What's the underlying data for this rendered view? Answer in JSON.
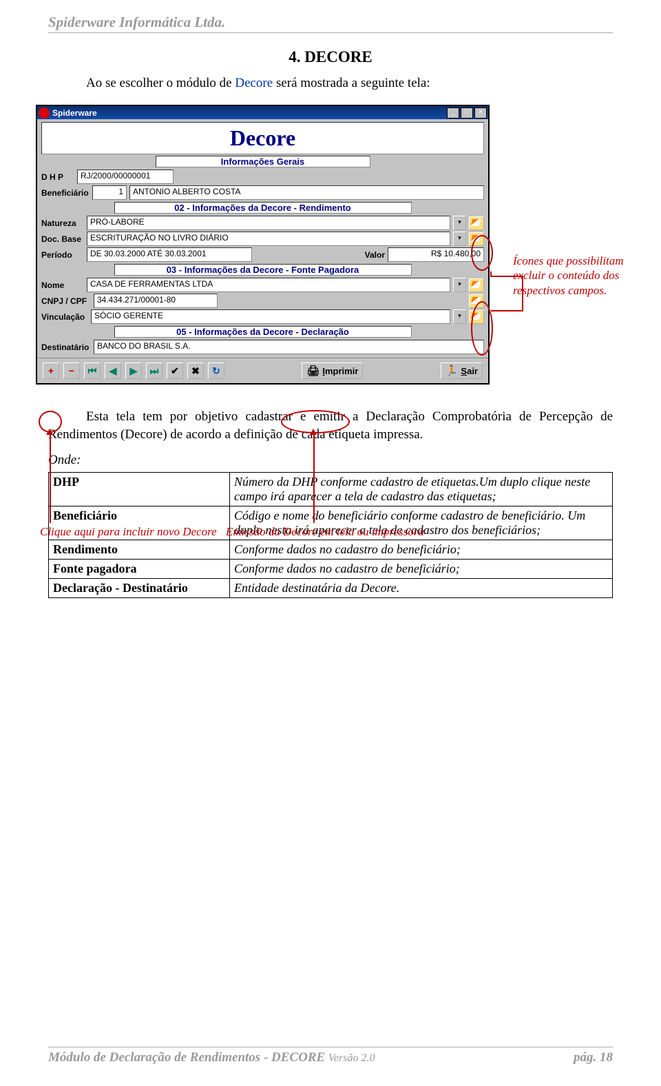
{
  "header": "Spiderware Informática Ltda.",
  "section_title": "4. DECORE",
  "intro": {
    "pre": "Ao se escolher o módulo de ",
    "link": "Decore",
    "post": " será  mostrada a seguinte tela:"
  },
  "window": {
    "app_title": "Spiderware",
    "main_title": "Decore",
    "group_general": "Informações Gerais",
    "dhp_label": "D H P",
    "dhp_value": "RJ/2000/00000001",
    "benef_label": "Beneficiário",
    "benef_code": "1",
    "benef_name": "ANTONIO ALBERTO COSTA",
    "group_02": "02 - Informações da Decore - Rendimento",
    "natureza_label": "Natureza",
    "natureza_value": "PRÓ-LABORE",
    "docbase_label": "Doc. Base",
    "docbase_value": "ESCRITURAÇÃO NO LIVRO DIÁRIO",
    "periodo_label": "Período",
    "periodo_value": "DE 30.03.2000 ATÉ 30.03.2001",
    "valor_label": "Valor",
    "valor_value": "R$ 10.480,00",
    "group_03": "03 - Informações da Decore - Fonte Pagadora",
    "nome_label": "Nome",
    "nome_value": "CASA DE FERRAMENTAS LTDA",
    "cnpj_label": "CNPJ / CPF",
    "cnpj_value": "34.434.271/00001-80",
    "vinc_label": "Vinculação",
    "vinc_value": "SÓCIO GERENTE",
    "group_05": "05 - Informações da Decore - Declaração",
    "dest_label": "Destinatário",
    "dest_value": "BANCO DO BRASIL S.A.",
    "imprimir_label": "Imprimir",
    "sair_label": "Sair"
  },
  "callouts": {
    "right": "Ícones que possibilitam excluir o conteúdo dos respectivos campos.",
    "left": "Clique aqui para incluir novo Decore",
    "mid": "Emissão da Decore em tela ou impressora"
  },
  "paragraph": "Esta tela tem por objetivo cadastrar e emitir a Declaração Comprobatória de Percepção de Rendimentos (Decore) de acordo a definição de cada etiqueta impressa.",
  "onde": "Onde:",
  "table": {
    "r1k": "DHP",
    "r1v": "Número da DHP conforme cadastro de etiquetas.Um duplo clique neste campo irá aparecer a tela de cadastro das etiquetas;",
    "r2k": "Beneficiário",
    "r2v": "Código e nome do beneficiário conforme cadastro de beneficiário. Um duplo nesta irá aparecer a tela de cadastro dos beneficiários;",
    "r3k": "Rendimento",
    "r3v": "Conforme dados no cadastro do beneficiário;",
    "r4k": "Fonte pagadora",
    "r4v": "Conforme dados no cadastro de beneficiário;",
    "r5k": "Declaração - Destinatário",
    "r5v": "Entidade destinatária da Decore."
  },
  "footer": {
    "left_pre": "Módulo de Declaração de Rendimentos - DECORE  ",
    "version": "Versão 2.0",
    "right": "pág.  18"
  }
}
